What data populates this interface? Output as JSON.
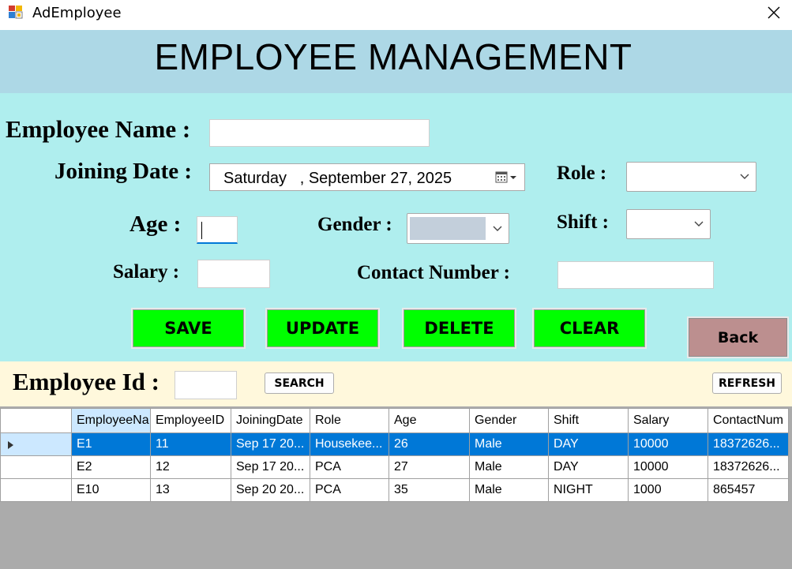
{
  "window": {
    "title": "AdEmployee",
    "icon": "app-icon",
    "close_icon": "close-icon"
  },
  "header": {
    "title": "EMPLOYEE MANAGEMENT",
    "color": "#add8e6"
  },
  "form": {
    "bg_color": "#afeeee",
    "employee_name_label": "Employee Name :",
    "employee_name_value": "",
    "joining_date_label": "Joining Date :",
    "joining_date_value": "Saturday   , September 27, 2025",
    "role_label": "Role :",
    "role_value": "",
    "age_label": "Age :",
    "age_value": "",
    "gender_label": "Gender :",
    "gender_value": "",
    "shift_label": "Shift :",
    "shift_value": "",
    "salary_label": "Salary :",
    "salary_value": "",
    "contact_label": "Contact Number :",
    "contact_value": ""
  },
  "buttons": {
    "save": "SAVE",
    "update": "UPDATE",
    "delete": "DELETE",
    "clear": "CLEAR",
    "back": "Back",
    "green_color": "#00ff00",
    "back_color": "#bc8f8f"
  },
  "search": {
    "bg_color": "#fff8dc",
    "label": "Employee Id :",
    "value": "",
    "search_button": "SEARCH",
    "refresh_button": "REFRESH"
  },
  "grid": {
    "columns": [
      "EmployeeNa",
      "EmployeeID",
      "JoiningDate",
      "Role",
      "Age",
      "Gender",
      "Shift",
      "Salary",
      "ContactNum"
    ],
    "rows": [
      {
        "cells": [
          "E1",
          "11",
          "Sep 17 20...",
          "Housekee...",
          "26",
          "Male",
          "DAY",
          "10000",
          "18372626..."
        ],
        "selected": true
      },
      {
        "cells": [
          "E2",
          "12",
          "Sep 17 20...",
          "PCA",
          "27",
          "Male",
          "DAY",
          "10000",
          "18372626..."
        ],
        "selected": false
      },
      {
        "cells": [
          "E10",
          "13",
          "Sep 20 20...",
          "PCA",
          "35",
          "Male",
          "NIGHT",
          "1000",
          "865457"
        ],
        "selected": false
      }
    ],
    "selection_color": "#0078d7"
  }
}
